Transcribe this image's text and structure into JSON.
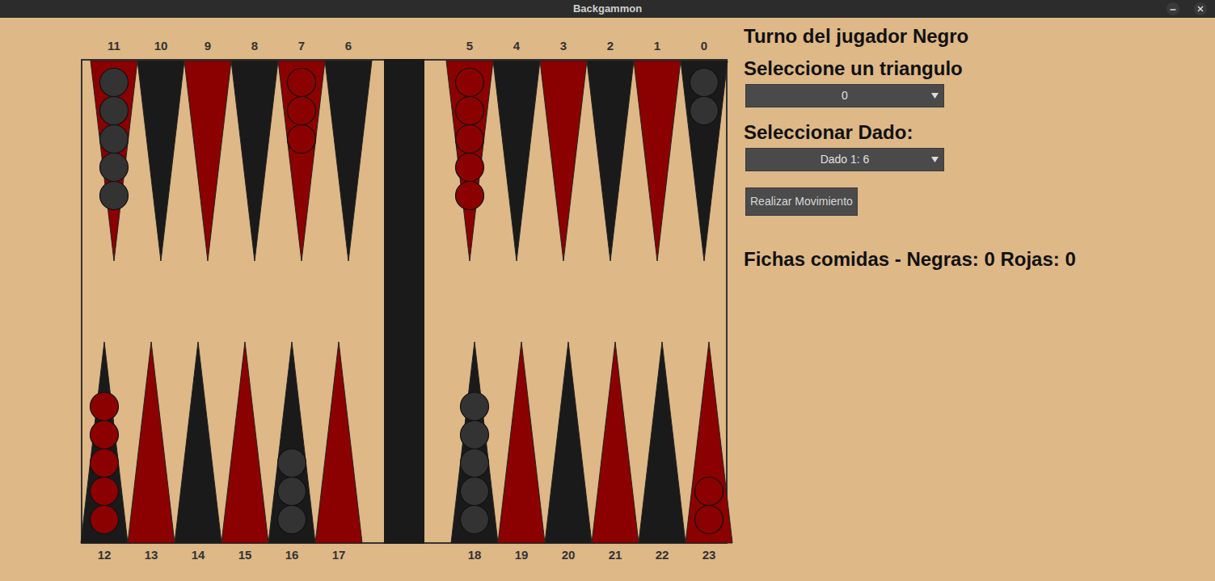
{
  "window": {
    "title": "Backgammon"
  },
  "board": {
    "points": [
      {
        "label": "0",
        "checkers": 2,
        "player": "black"
      },
      {
        "label": "1",
        "checkers": 0,
        "player": "none"
      },
      {
        "label": "2",
        "checkers": 0,
        "player": "none"
      },
      {
        "label": "3",
        "checkers": 0,
        "player": "none"
      },
      {
        "label": "4",
        "checkers": 0,
        "player": "none"
      },
      {
        "label": "5",
        "checkers": 5,
        "player": "red"
      },
      {
        "label": "6",
        "checkers": 0,
        "player": "none"
      },
      {
        "label": "7",
        "checkers": 3,
        "player": "red"
      },
      {
        "label": "8",
        "checkers": 0,
        "player": "none"
      },
      {
        "label": "9",
        "checkers": 0,
        "player": "none"
      },
      {
        "label": "10",
        "checkers": 0,
        "player": "none"
      },
      {
        "label": "11",
        "checkers": 5,
        "player": "black"
      },
      {
        "label": "12",
        "checkers": 5,
        "player": "red"
      },
      {
        "label": "13",
        "checkers": 0,
        "player": "none"
      },
      {
        "label": "14",
        "checkers": 0,
        "player": "none"
      },
      {
        "label": "15",
        "checkers": 0,
        "player": "none"
      },
      {
        "label": "16",
        "checkers": 3,
        "player": "black"
      },
      {
        "label": "17",
        "checkers": 0,
        "player": "none"
      },
      {
        "label": "18",
        "checkers": 5,
        "player": "black"
      },
      {
        "label": "19",
        "checkers": 0,
        "player": "none"
      },
      {
        "label": "20",
        "checkers": 0,
        "player": "none"
      },
      {
        "label": "21",
        "checkers": 0,
        "player": "none"
      },
      {
        "label": "22",
        "checkers": 0,
        "player": "none"
      },
      {
        "label": "23",
        "checkers": 2,
        "player": "red"
      }
    ]
  },
  "panel": {
    "turn": "Turno del jugador Negro",
    "triangle_label": "Seleccione un triangulo",
    "triangle_value": "0",
    "dice_label": "Seleccionar Dado:",
    "dice_value": "Dado 1: 6",
    "move_button": "Realizar Movimiento",
    "captured": "Fichas comidas - Negras: 0 Rojas: 0"
  }
}
